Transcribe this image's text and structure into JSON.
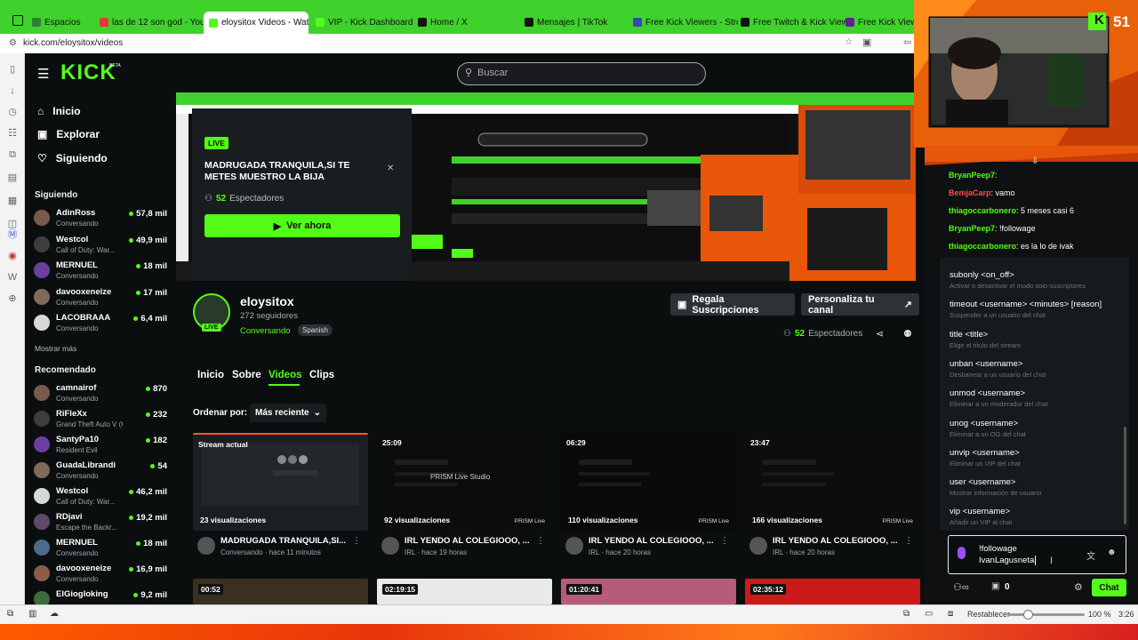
{
  "browser": {
    "tabs": [
      {
        "label": "Espacios",
        "color": "#2e7d32"
      },
      {
        "label": "las de 12 son god - YouTub",
        "color": "#e53935"
      },
      {
        "label": "eloysitox Videos - Watch O",
        "color": "#53fc18",
        "active": true
      },
      {
        "label": "VIP - Kick Dashboard",
        "color": "#53fc18"
      },
      {
        "label": "Home / X",
        "color": "#111111"
      },
      {
        "label": "Mensajes | TikTok",
        "color": "#111111"
      },
      {
        "label": "Free Kick Viewers - Stream",
        "color": "#3949ab"
      },
      {
        "label": "Free Twitch & Kick Viewers",
        "color": "#111111"
      },
      {
        "label": "Free Kick Viewers",
        "color": "#6a1b9a"
      }
    ],
    "url": "kick.com/eloysitox/videos",
    "status": {
      "reset_label": "Restablecer",
      "zoom": "100 %",
      "time": "3:26",
      "zoom_level": 0.2
    }
  },
  "kick": {
    "logo": "KICK",
    "logo_beta": "BETA",
    "search_placeholder": "Buscar",
    "nav": [
      {
        "label": "Inicio",
        "icon": "home-icon"
      },
      {
        "label": "Explorar",
        "icon": "compass-icon"
      },
      {
        "label": "Siguiendo",
        "icon": "heart-icon"
      }
    ],
    "following_title": "Siguiendo",
    "following": [
      {
        "name": "AdinRoss",
        "cat": "Conversando",
        "viewers": "57,8 mil"
      },
      {
        "name": "Westcol",
        "cat": "Call of Duty: War...",
        "viewers": "49,9 mil"
      },
      {
        "name": "MERNUEL",
        "cat": "Conversando",
        "viewers": "18 mil"
      },
      {
        "name": "davooxeneize",
        "cat": "Conversando",
        "viewers": "17 mil"
      },
      {
        "name": "LACOBRAAA",
        "cat": "Conversando",
        "viewers": "6,4 mil"
      }
    ],
    "show_more": "Mostrar más",
    "recommended_title": "Recomendado",
    "recommended": [
      {
        "name": "camnairof",
        "cat": "Conversando",
        "viewers": "870"
      },
      {
        "name": "RiFleXx",
        "cat": "Grand Theft Auto V (G...",
        "viewers": "232"
      },
      {
        "name": "SantyPa10",
        "cat": "Resident Evil",
        "viewers": "182"
      },
      {
        "name": "GuadaLibrandi",
        "cat": "Conversando",
        "viewers": "54"
      },
      {
        "name": "Westcol",
        "cat": "Call of Duty: War...",
        "viewers": "46,2 mil"
      },
      {
        "name": "RDjavi",
        "cat": "Escape the Backr...",
        "viewers": "19,2 mil"
      },
      {
        "name": "MERNUEL",
        "cat": "Conversando",
        "viewers": "18 mil"
      },
      {
        "name": "davooxeneize",
        "cat": "Conversando",
        "viewers": "16,9 mil"
      },
      {
        "name": "ElGiogloking",
        "cat": "",
        "viewers": "9,2 mil"
      }
    ],
    "live_card": {
      "badge": "LIVE",
      "title": "MADRUGADA TRANQUILA,SI TE METES MUESTRO LA BIJA",
      "viewers": "52",
      "viewers_label": "Espectadores",
      "cta": "Ver ahora"
    },
    "channel": {
      "name": "eloysitox",
      "followers": "272 seguidores",
      "category": "Conversando",
      "language": "Spanish",
      "live_badge": "LIVE",
      "gift_btn": "Regala Suscripciones",
      "customize_btn": "Personaliza tu canal",
      "viewers": "52",
      "viewers_label": "Espectadores"
    },
    "tabs": [
      "Inicio",
      "Sobre",
      "Videos",
      "Clips"
    ],
    "sort_label": "Ordenar por:",
    "sort_value": "Más reciente",
    "videos": [
      {
        "dur": "Stream actual",
        "views": "23 visualizaciones",
        "title": "MADRUGADA TRANQUILA,SI...",
        "sub": "Conversando",
        "ago": "hace 11 minutos",
        "wm": ""
      },
      {
        "dur": "25:09",
        "views": "92 visualizaciones",
        "title": "IRL YENDO AL COLEGIOOO, ...",
        "sub": "IRL",
        "ago": "hace 19 horas",
        "wm": "PRISM Live",
        "center": "PRISM Live Studio"
      },
      {
        "dur": "06:29",
        "views": "110 visualizaciones",
        "title": "IRL YENDO AL COLEGIOOO, ...",
        "sub": "IRL",
        "ago": "hace 20 horas",
        "wm": "PRISM Live"
      },
      {
        "dur": "23:47",
        "views": "166 visualizaciones",
        "title": "IRL YENDO AL COLEGIOOO, ...",
        "sub": "IRL",
        "ago": "hace 20 horas",
        "wm": "PRISM Live"
      }
    ],
    "videos_row2": [
      "00:52",
      "02:19:15",
      "01:20:41",
      "02:35:12"
    ]
  },
  "chat": {
    "overlay_count": "51",
    "messages": [
      {
        "user": "BryanPeep7",
        "color": "#53fc18",
        "text": ""
      },
      {
        "user": "BemjaCarp",
        "color": "#ff4d4d",
        "text": "vamo"
      },
      {
        "user": "thiagoccarbonero",
        "color": "#53fc18",
        "text": "5 meses casi 6"
      },
      {
        "user": "BryanPeep7",
        "color": "#53fc18",
        "text": "!followage"
      },
      {
        "user": "thiagoccarbonero",
        "color": "#53fc18",
        "text": "es la lo de ivak"
      }
    ],
    "commands": [
      {
        "cmd": "subonly <on_off>",
        "desc": "Activar o desactivar el modo solo-suscriptores"
      },
      {
        "cmd": "timeout <username> <minutes> [reason]",
        "desc": "Suspender a un usuario del chat"
      },
      {
        "cmd": "title <title>",
        "desc": "Elige el título del stream"
      },
      {
        "cmd": "unban <username>",
        "desc": "Desbanear a un usuario del chat"
      },
      {
        "cmd": "unmod <username>",
        "desc": "Eliminar a un moderador del chat"
      },
      {
        "cmd": "unog <username>",
        "desc": "Eliminar a un OG del chat"
      },
      {
        "cmd": "unvip <username>",
        "desc": "Eliminar un VIP del chat"
      },
      {
        "cmd": "user <username>",
        "desc": "Mostrar información de usuario"
      },
      {
        "cmd": "vip <username>",
        "desc": "Añadir un VIP al chat"
      }
    ],
    "input_line1": "!followage",
    "input_line2": "IvanLagusneta",
    "points": "0",
    "send_label": "Chat"
  }
}
